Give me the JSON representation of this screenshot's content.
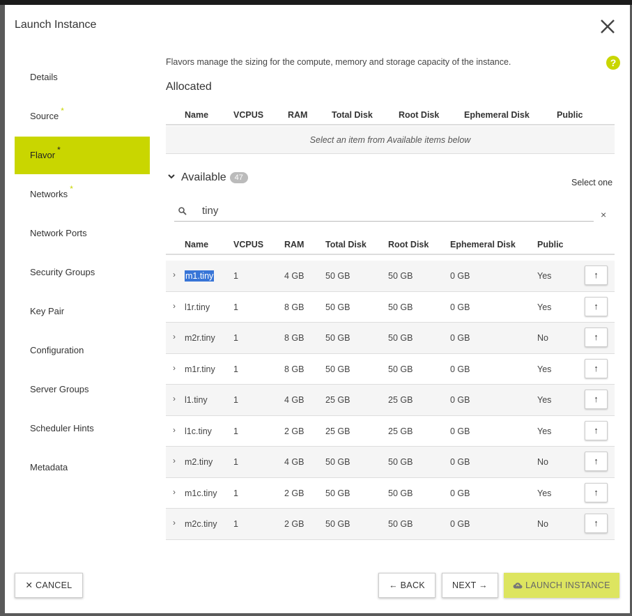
{
  "modal": {
    "title": "Launch Instance",
    "close_label": "×"
  },
  "sidebar": {
    "items": [
      {
        "label": "Details",
        "required": ""
      },
      {
        "label": "Source",
        "required": "*"
      },
      {
        "label": "Flavor",
        "required": "*"
      },
      {
        "label": "Networks",
        "required": "*"
      },
      {
        "label": "Network Ports",
        "required": ""
      },
      {
        "label": "Security Groups",
        "required": ""
      },
      {
        "label": "Key Pair",
        "required": ""
      },
      {
        "label": "Configuration",
        "required": ""
      },
      {
        "label": "Server Groups",
        "required": ""
      },
      {
        "label": "Scheduler Hints",
        "required": ""
      },
      {
        "label": "Metadata",
        "required": ""
      }
    ],
    "active": "Flavor"
  },
  "main": {
    "description": "Flavors manage the sizing for the compute, memory and storage capacity of the instance.",
    "help_icon": "?",
    "allocated": {
      "title": "Allocated",
      "columns": [
        "Name",
        "VCPUS",
        "RAM",
        "Total Disk",
        "Root Disk",
        "Ephemeral Disk",
        "Public"
      ],
      "empty_text": "Select an item from Available items below"
    },
    "available": {
      "title": "Available",
      "count": "47",
      "select_hint": "Select one",
      "search_value": "tiny",
      "clear_label": "×",
      "columns": [
        "Name",
        "VCPUS",
        "RAM",
        "Total Disk",
        "Root Disk",
        "Ephemeral Disk",
        "Public"
      ],
      "rows": [
        {
          "name": "m1.tiny",
          "vcpus": "1",
          "ram": "4 GB",
          "total_disk": "50 GB",
          "root_disk": "50 GB",
          "ephemeral_disk": "0 GB",
          "public": "Yes"
        },
        {
          "name": "l1r.tiny",
          "vcpus": "1",
          "ram": "8 GB",
          "total_disk": "50 GB",
          "root_disk": "50 GB",
          "ephemeral_disk": "0 GB",
          "public": "Yes"
        },
        {
          "name": "m2r.tiny",
          "vcpus": "1",
          "ram": "8 GB",
          "total_disk": "50 GB",
          "root_disk": "50 GB",
          "ephemeral_disk": "0 GB",
          "public": "No"
        },
        {
          "name": "m1r.tiny",
          "vcpus": "1",
          "ram": "8 GB",
          "total_disk": "50 GB",
          "root_disk": "50 GB",
          "ephemeral_disk": "0 GB",
          "public": "Yes"
        },
        {
          "name": "l1.tiny",
          "vcpus": "1",
          "ram": "4 GB",
          "total_disk": "25 GB",
          "root_disk": "25 GB",
          "ephemeral_disk": "0 GB",
          "public": "Yes"
        },
        {
          "name": "l1c.tiny",
          "vcpus": "1",
          "ram": "2 GB",
          "total_disk": "25 GB",
          "root_disk": "25 GB",
          "ephemeral_disk": "0 GB",
          "public": "Yes"
        },
        {
          "name": "m2.tiny",
          "vcpus": "1",
          "ram": "4 GB",
          "total_disk": "50 GB",
          "root_disk": "50 GB",
          "ephemeral_disk": "0 GB",
          "public": "No"
        },
        {
          "name": "m1c.tiny",
          "vcpus": "1",
          "ram": "2 GB",
          "total_disk": "50 GB",
          "root_disk": "50 GB",
          "ephemeral_disk": "0 GB",
          "public": "Yes"
        },
        {
          "name": "m2c.tiny",
          "vcpus": "1",
          "ram": "2 GB",
          "total_disk": "50 GB",
          "root_disk": "50 GB",
          "ephemeral_disk": "0 GB",
          "public": "No"
        }
      ]
    }
  },
  "footer": {
    "cancel_label": "CANCEL",
    "back_label": "BACK",
    "next_label": "NEXT",
    "launch_label": "LAUNCH INSTANCE"
  },
  "colors": {
    "accent": "#c9d600",
    "launch_button": "#dde560",
    "selection": "#3875d7"
  },
  "icons": {
    "close": "close-icon",
    "help": "help-icon",
    "search": "search-icon",
    "move_up": "arrow-up-icon",
    "upload": "cloud-upload-icon"
  }
}
